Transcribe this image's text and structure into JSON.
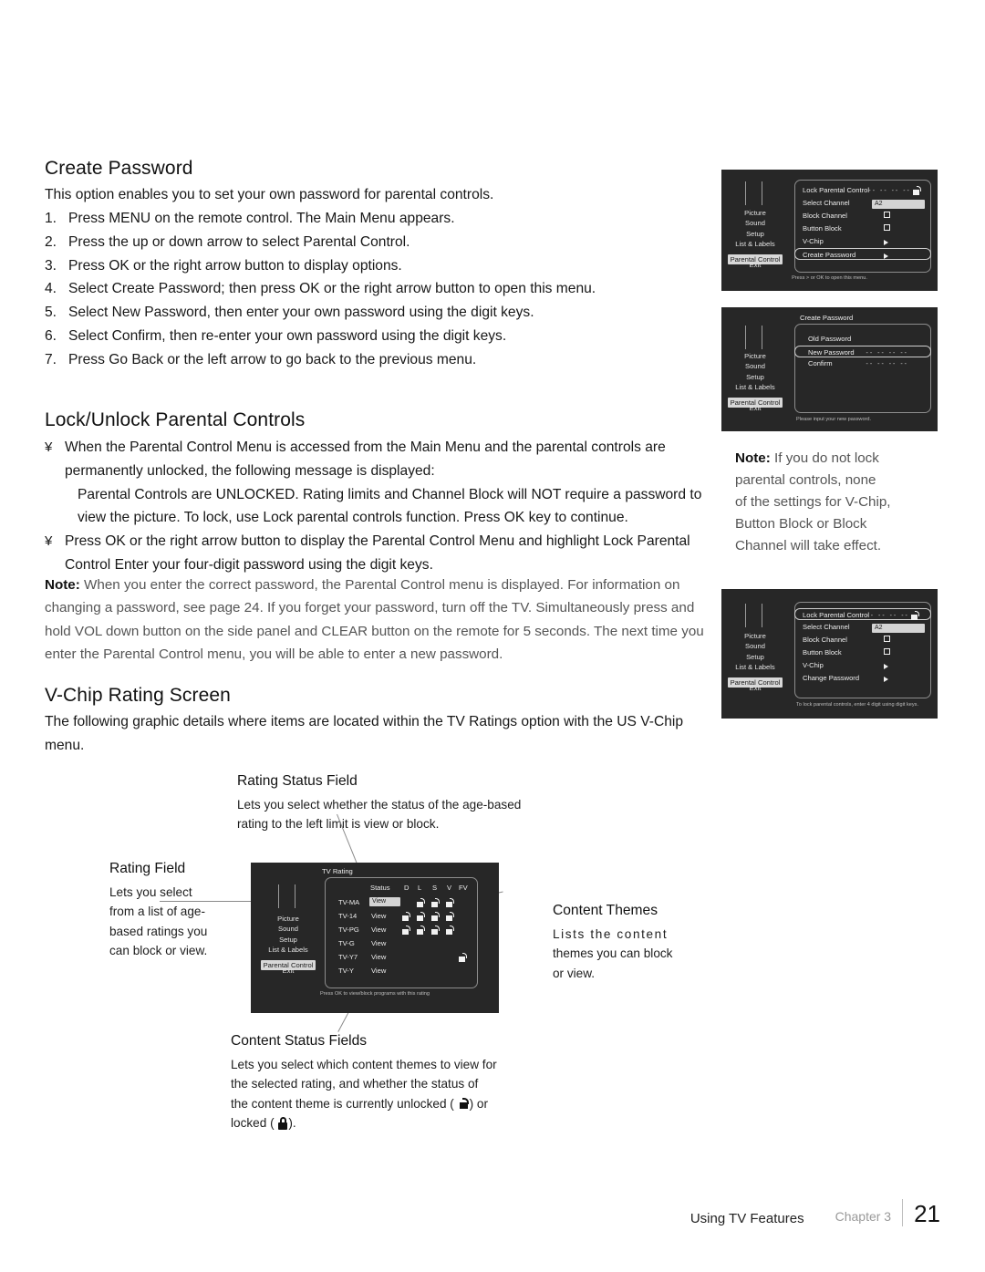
{
  "sections": {
    "create_password": {
      "heading": "Create Password",
      "intro": "This option enables you to set your own password for parental controls.",
      "steps": [
        "Press MENU on the remote control. The Main Menu appears.",
        "Press the up or down arrow to select Parental Control.",
        "Press OK or the right arrow button to display options.",
        "Select Create Password; then press OK or the right arrow button to open this menu.",
        "Select New Password, then enter your own password using the digit keys.",
        "Select Confirm, then re-enter your own password using the digit keys.",
        "Press Go Back or the left arrow to go back to the previous menu."
      ]
    },
    "lock_unlock": {
      "heading": "Lock/Unlock Parental Controls",
      "bullet_char": "¥",
      "bullet1": "When the Parental Control Menu is accessed from the Main Menu and the parental controls are permanently unlocked, the following message is displayed:",
      "bullet1_sub": "Parental Controls are UNLOCKED. Rating limits and Channel Block will NOT require a password to view the picture. To lock, use  Lock parental controls  function. Press OK key to continue.",
      "bullet2": "Press OK or the right arrow button to display the Parental Control Menu and highlight Lock Parental Control Enter your four-digit password using the digit keys.",
      "note_label": "Note:",
      "note_text": "When you enter the correct password, the Parental Control menu is displayed. For information on changing a password, see page 24. If you forget your password, turn off the TV. Simultaneously press and hold VOL down button on the side panel and CLEAR button on the remote for 5 seconds. The next time you enter the Parental Control menu, you will be able to enter a new password."
    },
    "side_note": {
      "label": "Note:",
      "line1": "If you do not lock",
      "line2": "parental controls, none",
      "line3": "of the settings for V-Chip,",
      "line4": "Button Block or Block",
      "line5": "Channel will take effect."
    },
    "vchip": {
      "heading": "V-Chip Rating Screen",
      "intro": "The following graphic details where items are located within the TV Ratings option with the US V-Chip menu."
    }
  },
  "osd_menus": {
    "parental_control": {
      "sidebar": [
        "Picture",
        "Sound",
        "Setup",
        "List & Labels",
        "Parental  Control",
        "Exit"
      ],
      "selected_sidebar": "Parental  Control",
      "rows": [
        {
          "label": "Lock Parental Control",
          "value_type": "dashes-lock",
          "value": "--  --  --  --"
        },
        {
          "label": "Select Channel",
          "value_type": "greybar",
          "value": "A2"
        },
        {
          "label": "Block Channel",
          "value_type": "checkbox",
          "value": ""
        },
        {
          "label": "Button Block",
          "value_type": "checkbox",
          "value": ""
        },
        {
          "label": "V-Chip",
          "value_type": "arrow",
          "value": ""
        },
        {
          "label": "Create Password",
          "value_type": "arrow",
          "value": ""
        }
      ],
      "highlighted_row": "Create Password",
      "hint": "Press > or OK to open this menu."
    },
    "create_password": {
      "title": "Create Password",
      "sidebar": [
        "Picture",
        "Sound",
        "Setup",
        "List & Labels",
        "Parental  Control",
        "Exit"
      ],
      "selected_sidebar": "Parental  Control",
      "rows": [
        {
          "label": "Old Password",
          "value": ""
        },
        {
          "label": "New Password",
          "value": "--  --  --  --"
        },
        {
          "label": "Confirm",
          "value": "--  --  --  --"
        }
      ],
      "highlighted_row": "New Password",
      "hint": "Please input your new password."
    },
    "lock_parental": {
      "sidebar": [
        "Picture",
        "Sound",
        "Setup",
        "List & Labels",
        "Parental  Control",
        "Exit"
      ],
      "selected_sidebar": "Parental  Control",
      "rows": [
        {
          "label": "Lock Parental Control",
          "value_type": "dashes-lock",
          "value": "--  --  --  --"
        },
        {
          "label": "Select Channel",
          "value_type": "greybar",
          "value": "A2"
        },
        {
          "label": "Block Channel",
          "value_type": "checkbox",
          "value": ""
        },
        {
          "label": "Button Block",
          "value_type": "checkbox",
          "value": ""
        },
        {
          "label": "V-Chip",
          "value_type": "arrow",
          "value": ""
        },
        {
          "label": "Change Password",
          "value_type": "arrow",
          "value": ""
        }
      ],
      "highlighted_row": "Lock Parental Control",
      "hint": "To lock parental controls, enter 4 digit using digit keys."
    },
    "tv_rating": {
      "title": "TV Rating",
      "sidebar": [
        "Picture",
        "Sound",
        "Setup",
        "List & Labels",
        "Parental  Control",
        "Exit"
      ],
      "selected_sidebar": "Parental  Control",
      "columns": [
        "Status",
        "D",
        "L",
        "S",
        "V",
        "FV"
      ],
      "rows": [
        {
          "rating": "TV-MA",
          "status": "View",
          "highlighted": true,
          "locks": {
            "D": false,
            "L": true,
            "S": true,
            "V": true,
            "FV": false
          }
        },
        {
          "rating": "TV-14",
          "status": "View",
          "highlighted": false,
          "locks": {
            "D": true,
            "L": true,
            "S": true,
            "V": true,
            "FV": false
          }
        },
        {
          "rating": "TV-PG",
          "status": "View",
          "highlighted": false,
          "locks": {
            "D": true,
            "L": true,
            "S": true,
            "V": true,
            "FV": false
          }
        },
        {
          "rating": "TV-G",
          "status": "View",
          "highlighted": false,
          "locks": {
            "D": false,
            "L": false,
            "S": false,
            "V": false,
            "FV": false
          }
        },
        {
          "rating": "TV-Y7",
          "status": "View",
          "highlighted": false,
          "locks": {
            "D": false,
            "L": false,
            "S": false,
            "V": false,
            "FV": true
          }
        },
        {
          "rating": "TV-Y",
          "status": "View",
          "highlighted": false,
          "locks": {
            "D": false,
            "L": false,
            "S": false,
            "V": false,
            "FV": false
          }
        }
      ],
      "hint": "Press OK  to view/block programs with this rating"
    }
  },
  "callouts": {
    "rating_status_field": {
      "heading": "Rating Status Field",
      "line1": "Lets you select whether the status of the age-based",
      "line2": "rating to the left limit is view or block."
    },
    "rating_field": {
      "heading": "Rating Field",
      "line1": "Lets you select",
      "line2": "from a list of age-",
      "line3": "based ratings you",
      "line4": "can block or view."
    },
    "content_themes": {
      "heading": "Content Themes",
      "line1": "Lists the content",
      "line2": "themes you can block",
      "line3": "or view."
    },
    "content_status_fields": {
      "heading": "Content Status Fields",
      "line1": "Lets you select which content themes to view for",
      "line2": "the selected rating, and whether the status of",
      "line3_a": "the content theme is currently unlocked (",
      "line3_b": ") or",
      "line4_a": "locked (",
      "line4_b": ")."
    }
  },
  "footer": {
    "section": "Using TV Features",
    "chapter": "Chapter 3",
    "page": "21"
  }
}
